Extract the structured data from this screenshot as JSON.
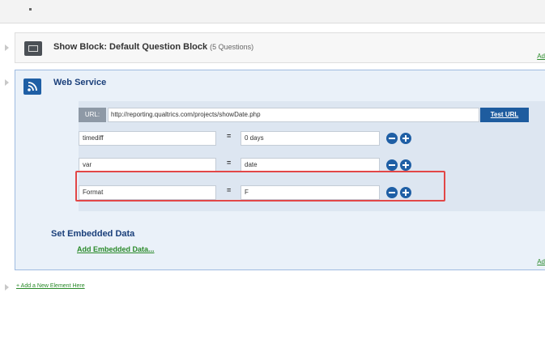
{
  "show_block": {
    "title": "Show Block: Default Question Block",
    "count": "(5 Questions)",
    "add_link": "Ad"
  },
  "web_service": {
    "title": "Web Service",
    "url_label": "URL:",
    "url_value": "http://reporting.qualtrics.com/projects/showDate.php",
    "test_button": "Test URL",
    "params": [
      {
        "key": "timediff",
        "equals": "=",
        "value": "0 days"
      },
      {
        "key": "var",
        "equals": "=",
        "value": "date"
      },
      {
        "key": "Format",
        "equals": "=",
        "value": "F"
      }
    ],
    "set_embedded_title": "Set Embedded Data",
    "add_embedded_link": "Add Embedded Data...",
    "add_link": "Ad"
  },
  "add_element_link": "+ Add a New Element Here",
  "colors": {
    "accent_blue": "#1f5fa5",
    "highlight_red": "#e24747",
    "link_green": "#2a8a2a"
  },
  "icons": {
    "show_block": "block-icon",
    "web_service": "rss-icon",
    "remove": "minus-circle-icon",
    "add": "plus-circle-icon"
  }
}
